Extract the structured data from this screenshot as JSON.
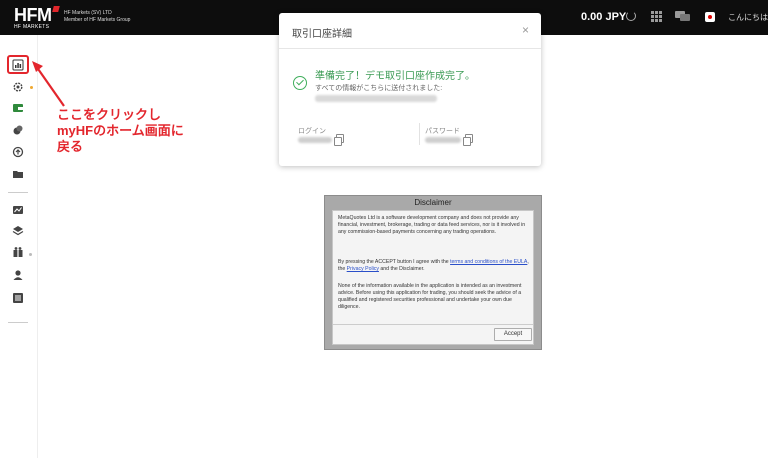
{
  "topbar": {
    "logo_text": "HFM",
    "logo_sub": "HF MARKETS",
    "entity_line1": "HF Markets (SV) LTD",
    "entity_line2": "Member of HF Markets Group",
    "balance": "0.00 JPY",
    "greeting": "こんにちは"
  },
  "sidebar": {
    "icons": [
      "dashboard-icon",
      "gear-icon",
      "wallet-icon",
      "coins-icon",
      "transfer-icon",
      "folder-icon",
      "chart-icon",
      "layers-icon",
      "gift-icon",
      "user-icon",
      "list-icon"
    ]
  },
  "annotation": {
    "line1": "ここをクリックし",
    "line2": "myHFのホーム画面に",
    "line3": "戻る",
    "color": "#e3262d"
  },
  "account_modal": {
    "title": "取引口座詳細",
    "close": "×",
    "ready_text": "準備完了！デモ取引口座作成完了。",
    "sent_info": "すべての情報がこちらに送付されました:",
    "login_label": "ログイン",
    "password_label": "パスワード",
    "success_color": "#3fae5b"
  },
  "disclaimer": {
    "title": "Disclaimer",
    "p1": "MetaQuotes Ltd is a software development company and does not provide any financial, investment, brokerage, trading or data feed services, nor is it involved in any commission-based payments concerning any trading operations.",
    "p2_a": "By pressing the ACCEPT button I agree with the ",
    "p2_link1": "terms and conditions of the EULA",
    "p2_b": ", the ",
    "p2_link2": "Privacy Policy",
    "p2_c": " and the Disclaimer.",
    "p3": "None of the information available in the application is intended as an investment advice. Before using this application for trading, you should seek the advice of a qualified and registered securities professional and undertake your own due diligence.",
    "accept_label": "Accept"
  }
}
